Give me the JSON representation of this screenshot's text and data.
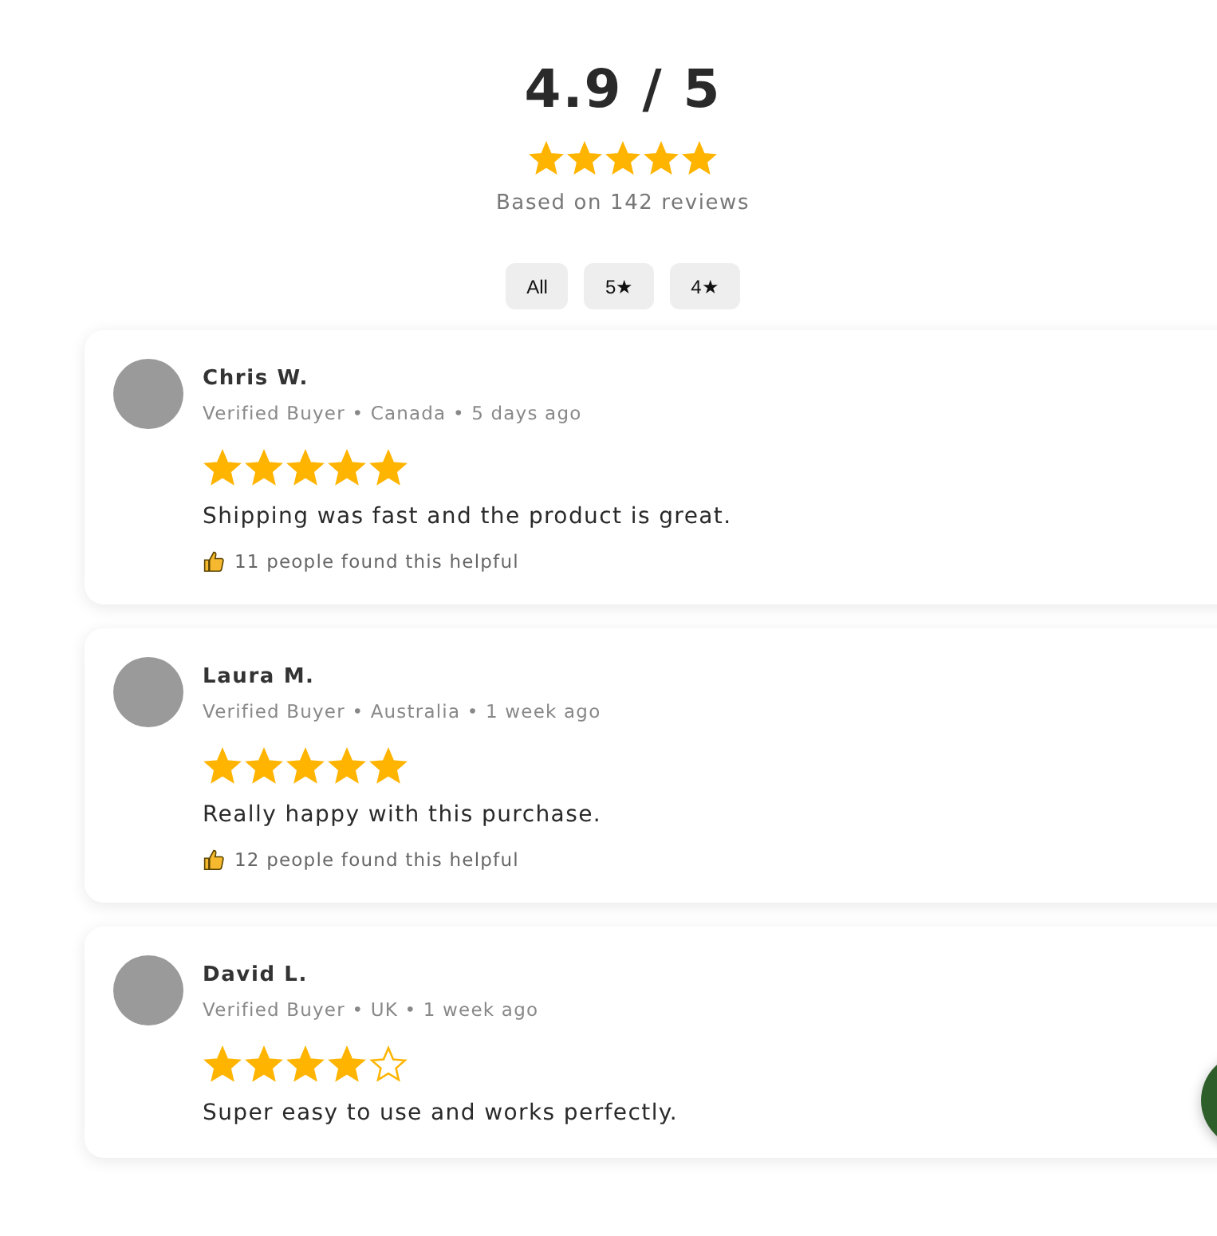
{
  "summary": {
    "score": "4.9 / 5",
    "stars": 5,
    "count_text": "Based on 142 reviews"
  },
  "filters": [
    {
      "label": "All",
      "selected": false
    },
    {
      "label": "5★",
      "selected": false
    },
    {
      "label": "4★",
      "selected": false
    }
  ],
  "reviews": [
    {
      "name": "Chris W.",
      "meta": "Verified Buyer • Canada • 5 days ago",
      "stars": 5,
      "text": "Shipping was fast and the product is great.",
      "helpful": "11 people found this helpful"
    },
    {
      "name": "Laura M.",
      "meta": "Verified Buyer • Australia • 1 week ago",
      "stars": 5,
      "text": "Really happy with this purchase.",
      "helpful": "12 people found this helpful"
    },
    {
      "name": "David L.",
      "meta": "Verified Buyer • UK • 1 week ago",
      "stars": 4,
      "text": "Super easy to use and works perfectly."
    }
  ]
}
